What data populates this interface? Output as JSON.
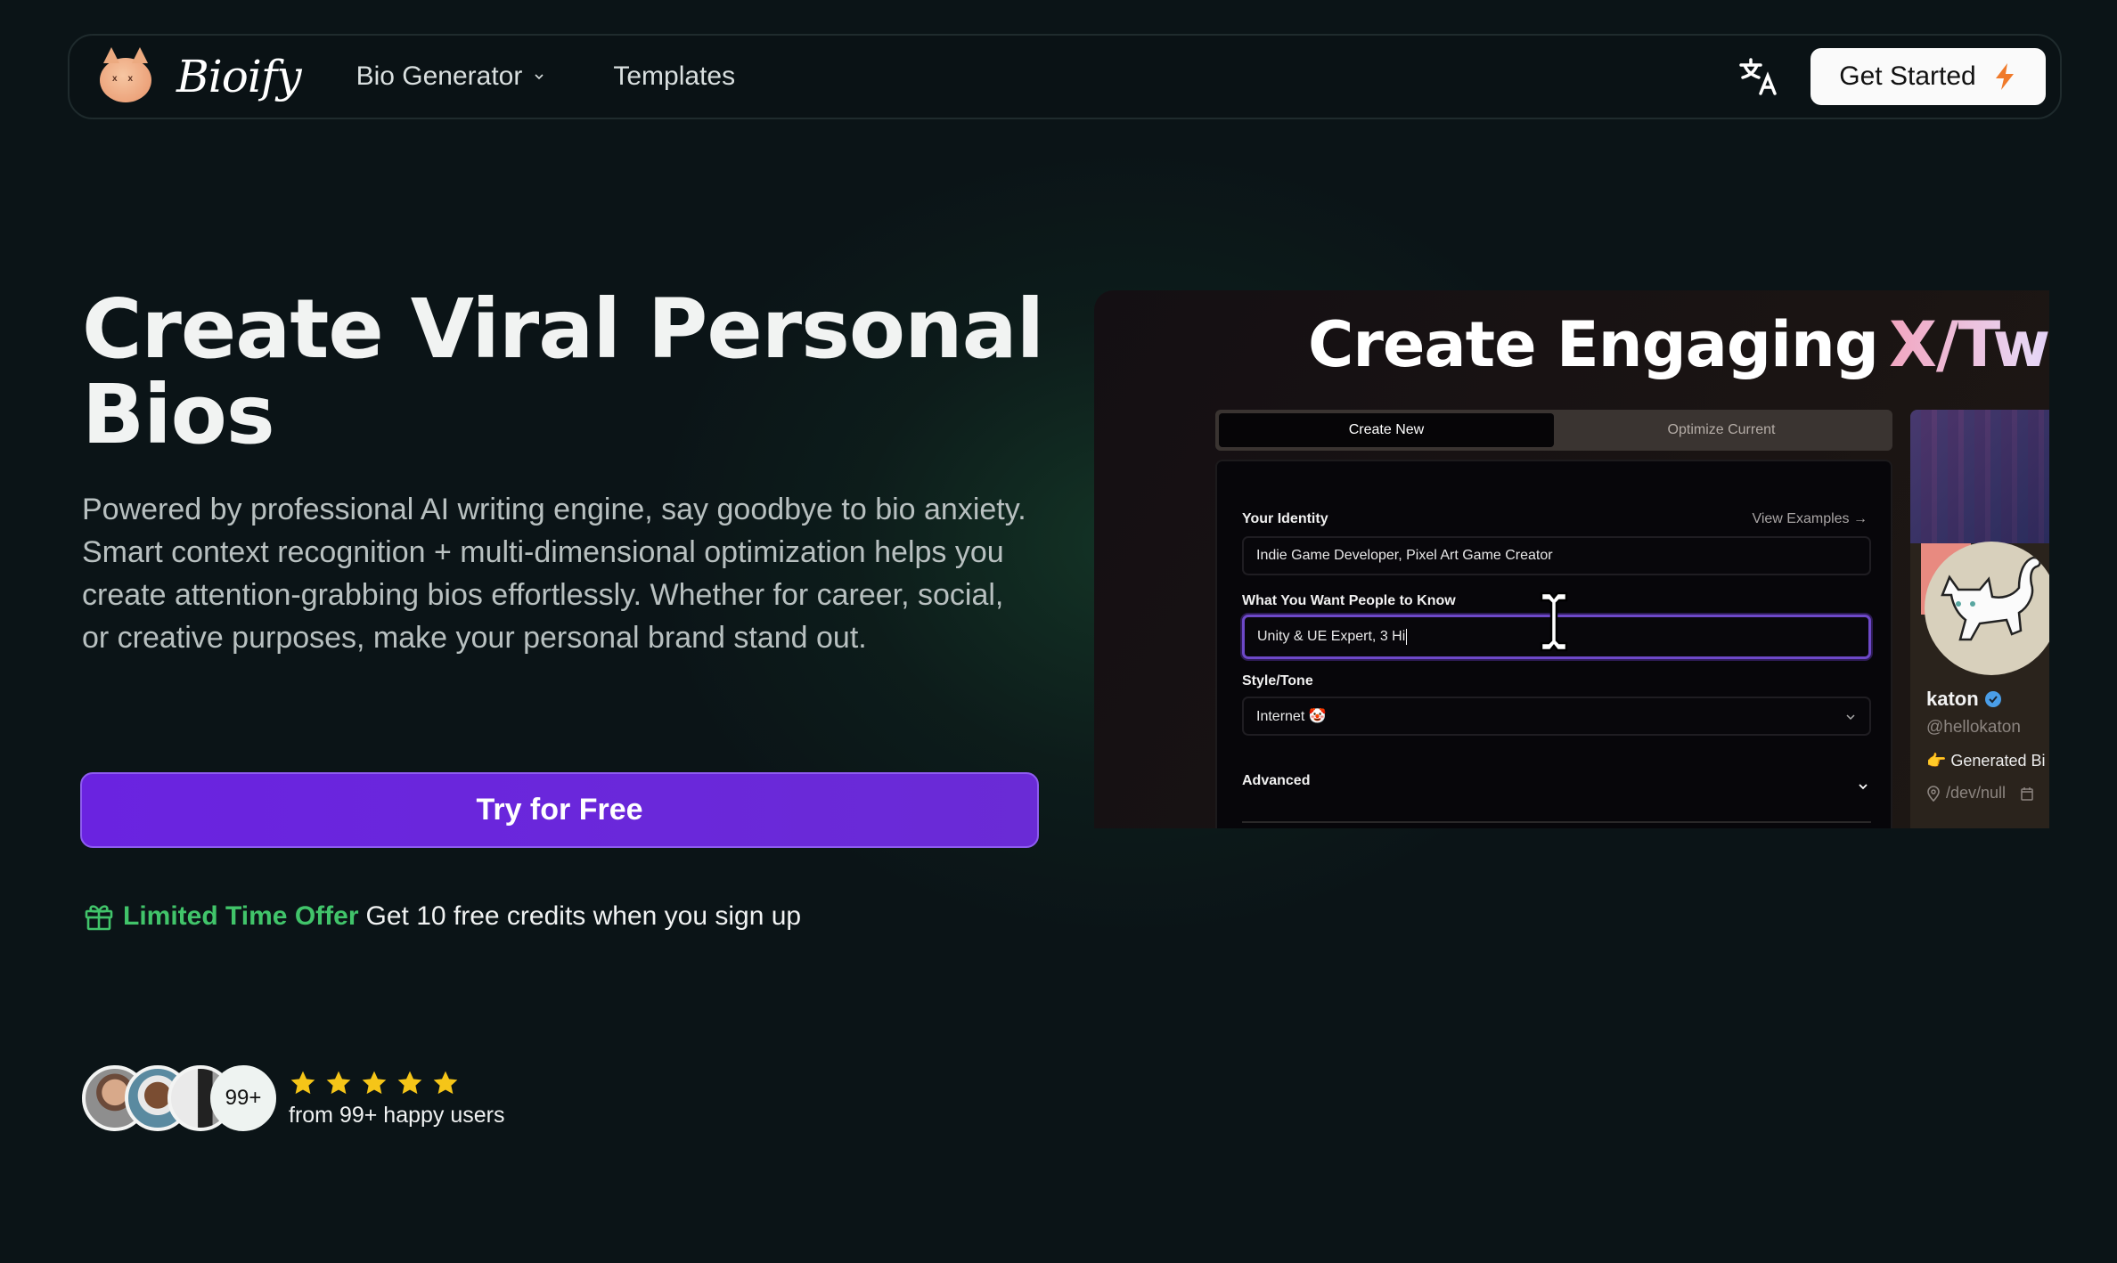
{
  "nav": {
    "brand": "Bioify",
    "links": [
      {
        "label": "Bio Generator",
        "has_dropdown": true
      },
      {
        "label": "Templates",
        "has_dropdown": false
      }
    ],
    "language_icon": "translate-icon",
    "cta_label": "Get Started",
    "cta_icon": "lightning-bolt-icon"
  },
  "hero": {
    "title": "Create Viral Personal Bios",
    "description": "Powered by professional AI writing engine, say goodbye to bio anxiety. Smart context recognition + multi-dimensional optimization helps you create attention-grabbing bios effortlessly. Whether for career, social, or creative purposes, make your personal brand stand out.",
    "primary_button": "Try for Free",
    "offer": {
      "icon": "gift-icon",
      "highlight": "Limited Time Offer",
      "text": "Get 10 free credits when you sign up"
    },
    "social_proof": {
      "avatar_count_label": "99+",
      "rating": 5,
      "rating_max": 5,
      "caption": "from 99+ happy users"
    }
  },
  "preview": {
    "title_main": "Create Engaging",
    "title_accent": "X/Twitt",
    "tabs": [
      {
        "label": "Create New",
        "active": true
      },
      {
        "label": "Optimize Current",
        "active": false
      }
    ],
    "form": {
      "identity_label": "Your Identity",
      "view_examples": "View Examples →",
      "identity_value": "Indie Game Developer, Pixel Art Game Creator",
      "know_label": "What You Want People to Know",
      "know_value": "Unity & UE Expert, 3 Hi",
      "style_label": "Style/Tone",
      "style_value": "Internet 🤡",
      "advanced_label": "Advanced"
    },
    "profile": {
      "name": "katon",
      "handle": "@hellokaton",
      "bio": "👉 Generated Bi",
      "location": "/dev/null"
    }
  },
  "colors": {
    "accent_purple": "#6a23e0",
    "offer_green": "#41c46a",
    "star_yellow": "#f5c518",
    "bolt_orange": "#f07a2a"
  }
}
